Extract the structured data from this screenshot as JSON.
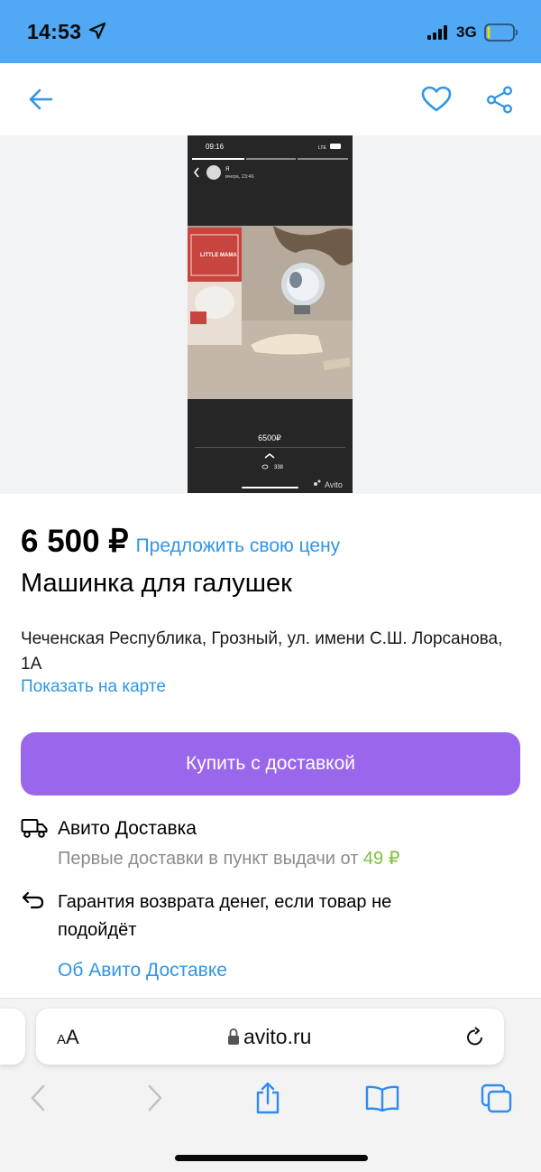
{
  "status_bar": {
    "time": "14:53",
    "network": "3G",
    "icons": [
      "location-arrow-icon",
      "signal-icon",
      "battery-icon"
    ]
  },
  "header": {
    "icons": [
      "back-arrow-icon",
      "heart-icon",
      "share-icon"
    ],
    "accent_color": "#2f96e8"
  },
  "gallery": {
    "screenshot": {
      "time": "09:16",
      "network": "LTE",
      "user_name": "Я",
      "user_time": "вчера, 23:46",
      "price": "6500₽",
      "views": "338",
      "watermark": "Avito",
      "box_text": "LITTLE MAMA"
    }
  },
  "listing": {
    "price": "6 500 ₽",
    "offer_price_link": "Предложить свою цену",
    "title": "Машинка для галушек",
    "address": "Чеченская Республика, Грозный, ул. имени С.Ш. Лорсанова, 1А",
    "map_link": "Показать на карте",
    "buy_button": "Купить с доставкой",
    "buy_button_color": "#9a66ec"
  },
  "delivery": {
    "title": "Авито Доставка",
    "subtitle_prefix": "Первые доставки в пункт выдачи от",
    "subtitle_price": "49 ₽",
    "guarantee": "Гарантия возврата денег, если товар не подойдёт",
    "about_link": "Об Авито Доставке"
  },
  "browser": {
    "text_size_label_small": "A",
    "text_size_label_large": "A",
    "url": "avito.ru",
    "toolbar_icons": [
      "back-icon",
      "forward-icon",
      "share-icon",
      "bookmarks-icon",
      "tabs-icon"
    ]
  }
}
